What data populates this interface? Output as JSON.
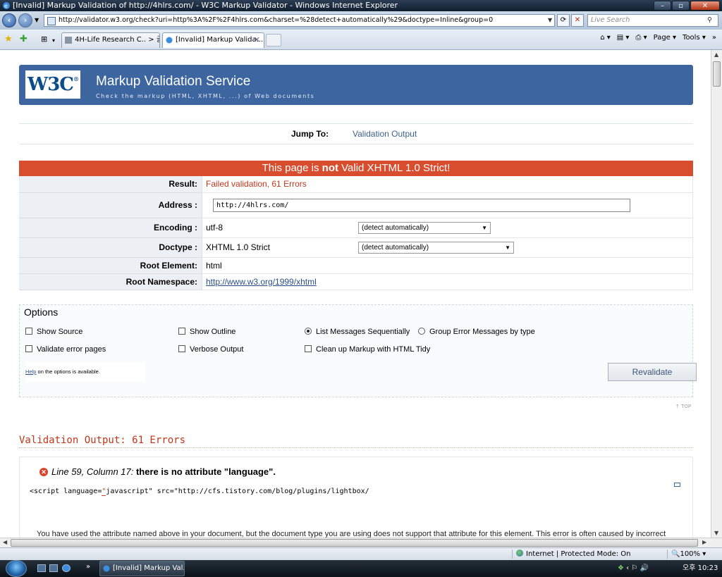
{
  "window": {
    "title": "[Invalid] Markup Validation of http://4hlrs.com/ - W3C Markup Validator - Windows Internet Explorer",
    "minimize": "–",
    "maximize": "▫",
    "close": "✕"
  },
  "nav": {
    "back": "‹",
    "forward": "›",
    "url": "http://validator.w3.org/check?uri=http%3A%2F%2F4hlrs.com&charset=%28detect+automatically%29&doctype=Inline&group=0",
    "search_placeholder": "Live Search"
  },
  "tabs": [
    {
      "label": "4H-Life Research C.. > 글"
    },
    {
      "label": "[Invalid] Markup Valida..."
    }
  ],
  "command_bar": {
    "page": "Page ▾",
    "tools": "Tools ▾"
  },
  "banner": {
    "logo": "W3C",
    "logo_mark": "®",
    "title": "Markup Validation Service",
    "subtitle": "Check the markup (HTML, XHTML, ...) of Web documents"
  },
  "jump": {
    "label": "Jump To:",
    "link": "Validation Output"
  },
  "result": {
    "header_pre": "This page is ",
    "header_bold": "not",
    "header_post": " Valid XHTML 1.0 Strict!",
    "rows": {
      "result_label": "Result:",
      "result_value": "Failed validation, 61 Errors",
      "address_label": "Address :",
      "address_value": "http://4hlrs.com/",
      "encoding_label": "Encoding :",
      "encoding_value": "utf-8",
      "encoding_select": "(detect automatically)",
      "doctype_label": "Doctype :",
      "doctype_value": "XHTML 1.0 Strict",
      "doctype_select": "(detect automatically)",
      "root_label": "Root Element:",
      "root_value": "html",
      "ns_label": "Root Namespace:",
      "ns_value": "http://www.w3.org/1999/xhtml"
    }
  },
  "options": {
    "title": "Options",
    "show_source": "Show Source",
    "show_outline": "Show Outline",
    "list_sequential": "List Messages Sequentially",
    "group_by_type": "Group Error Messages by type",
    "validate_error_pages": "Validate error pages",
    "verbose_output": "Verbose Output",
    "clean_up": "Clean up Markup with HTML Tidy",
    "help_link": "Help",
    "help_text": " on the options is available.",
    "revalidate": "Revalidate",
    "top_link": "↑ TOP"
  },
  "output": {
    "title": "Validation Output: 61 Errors",
    "error": {
      "location": "Line 59, Column 17:",
      "message": " there is no attribute \"language\".",
      "code_pre": "<script language=",
      "code_mark": "\"",
      "code_post": "javascript\" src=\"http://cfs.tistory.com/blog/plugins/lightbox/",
      "description": "You have used the attribute named above in your document, but the document type you are using does not support that attribute for this element. This error is often caused by incorrect"
    }
  },
  "status": {
    "zone": "Internet | Protected Mode: On",
    "zoom": "100%"
  },
  "taskbar": {
    "task": "[Invalid] Markup Val...",
    "clock": "오후 10:23"
  }
}
